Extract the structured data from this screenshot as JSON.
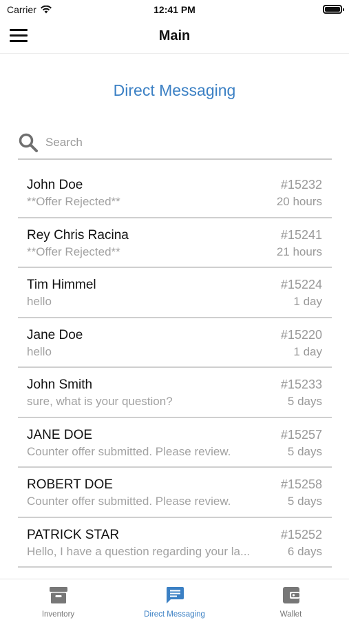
{
  "status_bar": {
    "carrier": "Carrier",
    "time": "12:41 PM"
  },
  "nav": {
    "title": "Main",
    "menu_icon": "hamburger-menu-icon"
  },
  "page": {
    "heading": "Direct Messaging"
  },
  "search": {
    "placeholder": "Search",
    "value": "",
    "icon": "search-icon"
  },
  "messages": [
    {
      "name": "John Doe",
      "preview": "**Offer Rejected**",
      "id": "#15232",
      "time": "20 hours"
    },
    {
      "name": "Rey Chris Racina",
      "preview": "**Offer Rejected**",
      "id": "#15241",
      "time": "21 hours"
    },
    {
      "name": "Tim Himmel",
      "preview": "hello",
      "id": "#15224",
      "time": "1 day"
    },
    {
      "name": "Jane Doe",
      "preview": "hello",
      "id": "#15220",
      "time": "1 day"
    },
    {
      "name": "John Smith",
      "preview": "sure, what is your question?",
      "id": "#15233",
      "time": "5 days"
    },
    {
      "name": "JANE DOE",
      "preview": "Counter offer submitted. Please review.",
      "id": "#15257",
      "time": "5 days"
    },
    {
      "name": "ROBERT DOE",
      "preview": "Counter offer submitted. Please review.",
      "id": "#15258",
      "time": "5 days"
    },
    {
      "name": "PATRICK STAR",
      "preview": "Hello, I have a question regarding your la...",
      "id": "#15252",
      "time": "6 days"
    }
  ],
  "tabs": [
    {
      "label": "Inventory",
      "icon": "archive-box-icon",
      "active": false
    },
    {
      "label": "Direct Messaging",
      "icon": "chat-message-icon",
      "active": true
    },
    {
      "label": "Wallet",
      "icon": "wallet-icon",
      "active": false
    }
  ],
  "colors": {
    "accent": "#3b80c4",
    "tab_inactive": "#777777",
    "secondary_text": "#9a9a9a",
    "divider": "#cfcfcf"
  }
}
